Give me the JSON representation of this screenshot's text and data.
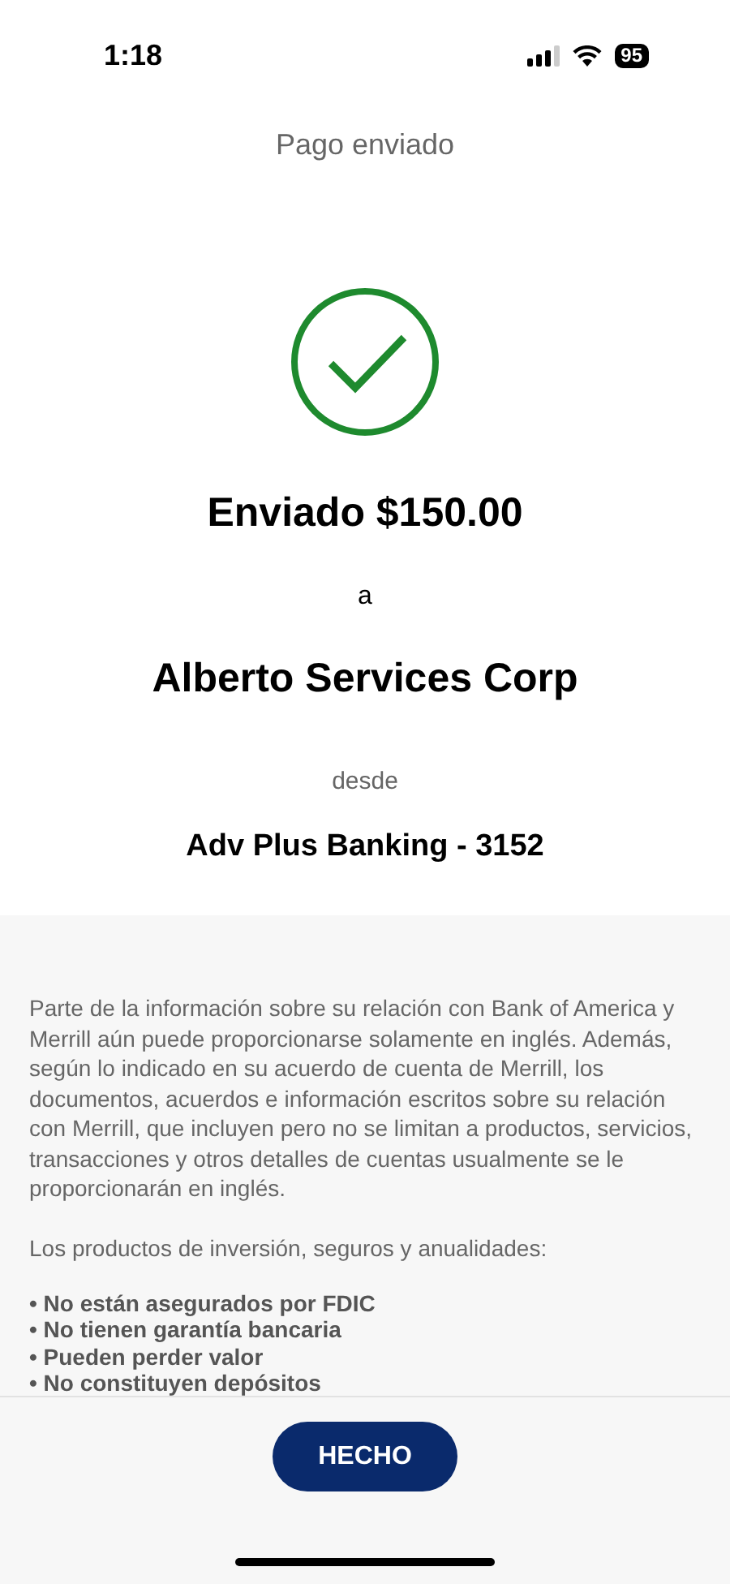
{
  "status_bar": {
    "time": "1:18",
    "battery": "95"
  },
  "header": {
    "title": "Pago enviado"
  },
  "confirmation": {
    "amount_line": "Enviado $150.00",
    "connector_to": "a",
    "payee": "Alberto Services Corp",
    "connector_from": "desde",
    "account": "Adv Plus Banking - 3152"
  },
  "disclosure": {
    "paragraph": "Parte de la información sobre su relación con Bank of America y Merrill aún puede proporcionarse solamente en inglés. Además, según lo indicado en su acuerdo de cuenta de Merrill, los documentos, acuerdos e información escritos sobre su relación con Merrill, que incluyen pero no se limitan a productos, servicios, transacciones y otros detalles de cuentas usualmente se le proporcionarán en inglés.",
    "list_intro": "Los productos de inversión, seguros y anualidades:",
    "bullets": [
      "• No están asegurados por FDIC",
      "• No tienen garantía bancaria",
      "• Pueden perder valor",
      "• No constituyen depósitos"
    ]
  },
  "done_button": {
    "label": "HECHO"
  }
}
